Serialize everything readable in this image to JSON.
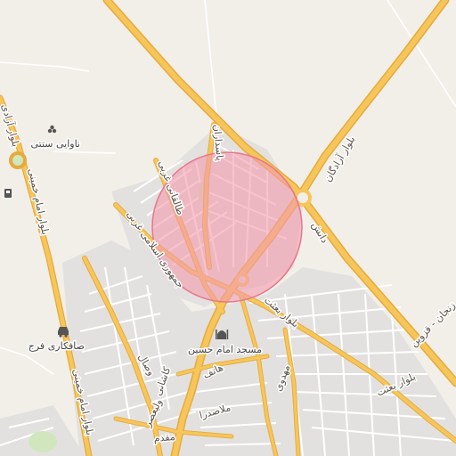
{
  "map": {
    "background_color": "#f2efe9",
    "road_major_color": "#f6c65b",
    "road_major_casing": "#e6aa3c",
    "road_minor_color": "#ffffff",
    "block_color": "#e3e1df",
    "park_color": "#d1e6bd",
    "highlight_fill": "#f49bad",
    "highlight_stroke": "#e8768c",
    "highlight_opacity": 0.6
  },
  "road_labels": {
    "bolvar_azadegan": "بلوار آزادگان",
    "daneshjoo": "دانش",
    "bolvar_besat_1": "بلوار بعثت",
    "bolvar_besat_2": "بلوار بعثت",
    "zanjan_qazvin": "زنجان - قزوین",
    "jomhouri": "جمهوری اسلامی غربی",
    "taleghani": "طالقانی غربی",
    "pasdaran": "پاسداران",
    "imam_khomeini_1": "بلوار امام خمینی",
    "imam_khomeini_2": "بلوار امام خمینی",
    "azadi": "بلوار آزادی",
    "vesal": "وصال",
    "kashani": "کاشانی",
    "valiasr": "ولیعصر",
    "hatef": "هاتف",
    "mollasadra": "ملاصدرا",
    "mofatteh": "مفتح",
    "mahdavi": "مهدوی",
    "moghadam": "مقدم"
  },
  "pois": {
    "industrial": "ناوایی ستتی",
    "industrial_icon": "industry-icon",
    "car_wash": "صافکاری فرج",
    "car_wash_icon": "car-icon",
    "mosque": "مسجد امام حسین",
    "mosque_icon": "mosque-icon",
    "fuel_icon": "fuel-icon"
  }
}
